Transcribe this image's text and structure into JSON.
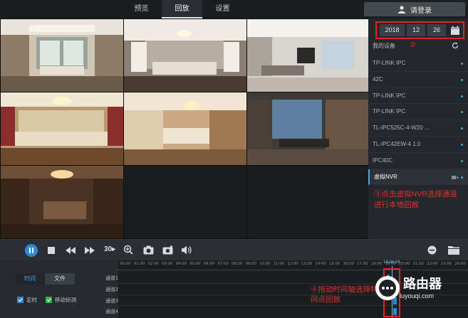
{
  "nav": {
    "tabs": [
      "预览",
      "回放",
      "设置"
    ],
    "active_tab": "回放",
    "login_label": "请登录"
  },
  "date": {
    "year": "2018",
    "month": "12",
    "day": "26"
  },
  "annotations": {
    "step2": "②",
    "step3": "③点击虚拟NVR选择通道进行本地回放",
    "step4": "④拖动时间轴选择特定时间点回放"
  },
  "devices": {
    "title": "我的设备",
    "items": [
      "TP-LINK IPC",
      "42C",
      "TP-LINK IPC",
      "TP-LINK IPC",
      "TL-IPC525C-4-W20 ...",
      "TL-IPC42EW-4 1.0",
      "IPC40C",
      "虚拟NVR"
    ],
    "selected_index": 7
  },
  "playback_controls": {
    "speed_label": "30",
    "icons": [
      "pause-icon",
      "stop-icon",
      "rewind-icon",
      "fast-forward-icon",
      "speed-icon",
      "zoom-icon",
      "snapshot-icon",
      "record-icon",
      "volume-icon",
      "minus-icon",
      "folder-icon"
    ]
  },
  "mode": {
    "tabs": [
      "时间",
      "文件"
    ],
    "active": "时间"
  },
  "filters": [
    {
      "label": "定时",
      "checked": true,
      "color": "#2b8ad6"
    },
    {
      "label": "移动侦测",
      "checked": true,
      "color": "#26b552"
    }
  ],
  "timeline": {
    "ticks": [
      "00:00",
      "01:00",
      "02:00",
      "03:00",
      "04:00",
      "05:00",
      "06:00",
      "07:00",
      "08:00",
      "09:00",
      "10:00",
      "11:00",
      "12:00",
      "13:00",
      "14:00",
      "15:00",
      "16:00",
      "17:00",
      "18:00",
      "19:00",
      "20:00",
      "21:00",
      "22:00",
      "23:00",
      "24:00"
    ],
    "channels": [
      "通道1",
      "通道2",
      "通道3",
      "通道4"
    ],
    "current_time": "19:06:05"
  },
  "watermark": {
    "brand": "路由器",
    "url": "luyouqi.com"
  },
  "colors": {
    "accent": "#2b8ad6",
    "annotation": "#e03030",
    "motion": "#26b552"
  }
}
